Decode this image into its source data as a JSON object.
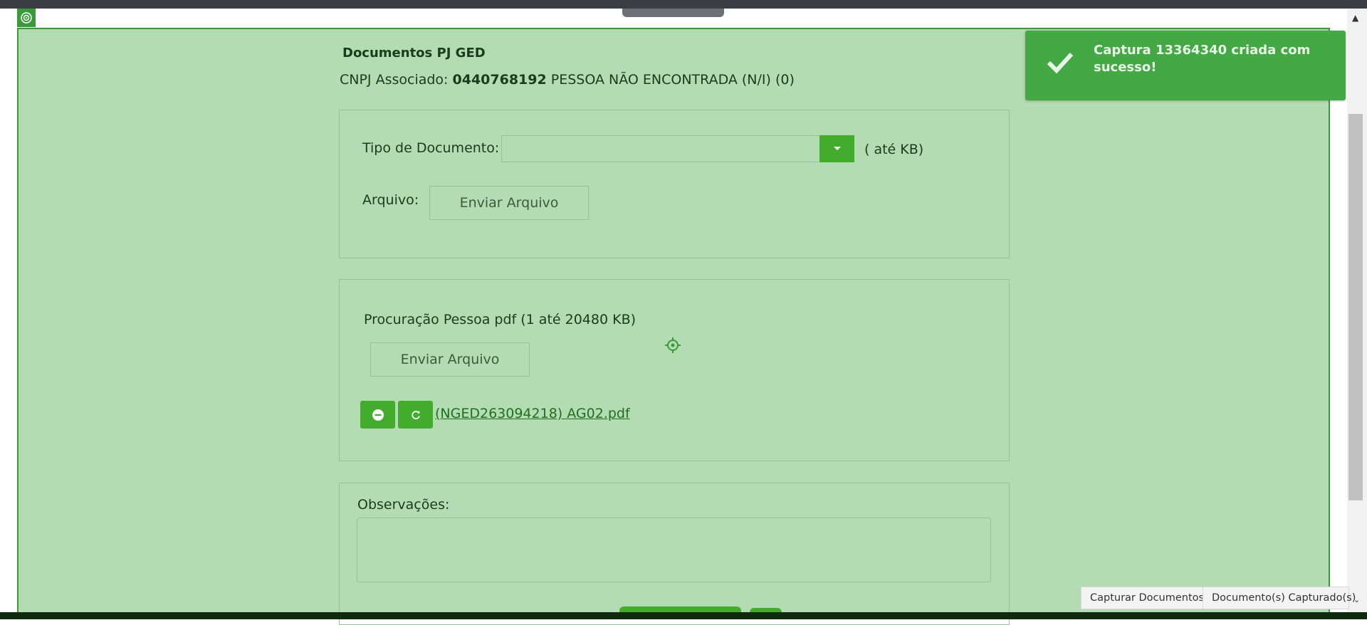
{
  "page": {
    "title": "Documentos PJ GED",
    "cnpj_label": "CNPJ Associado:",
    "cnpj_number": "0440768192",
    "cnpj_name": "PESSOA NÃO ENCONTRADA (N/I) (0)"
  },
  "upload_form": {
    "doc_type_label": "Tipo de Documento:",
    "doc_type_value": "",
    "doc_type_limit": "( até KB)",
    "file_label": "Arquivo:",
    "send_button": "Enviar Arquivo"
  },
  "procuracao": {
    "label": "Procuração Pessoa pdf (1 até 20480 KB)",
    "send_button": "Enviar Arquivo",
    "file_name": "(NGED263094218) AG02.pdf"
  },
  "observacoes": {
    "label": "Observações:",
    "value": ""
  },
  "toast": {
    "message": "Captura 13364340 criada com sucesso!",
    "icon": "check-icon"
  },
  "bottom_tabs": [
    {
      "label": "Capturar Documentos"
    },
    {
      "label": "Documento(s) Capturado(s)"
    }
  ],
  "colors": {
    "overlay": "#b3dcb3",
    "accent": "#44ac2c",
    "toast": "#44a844"
  }
}
